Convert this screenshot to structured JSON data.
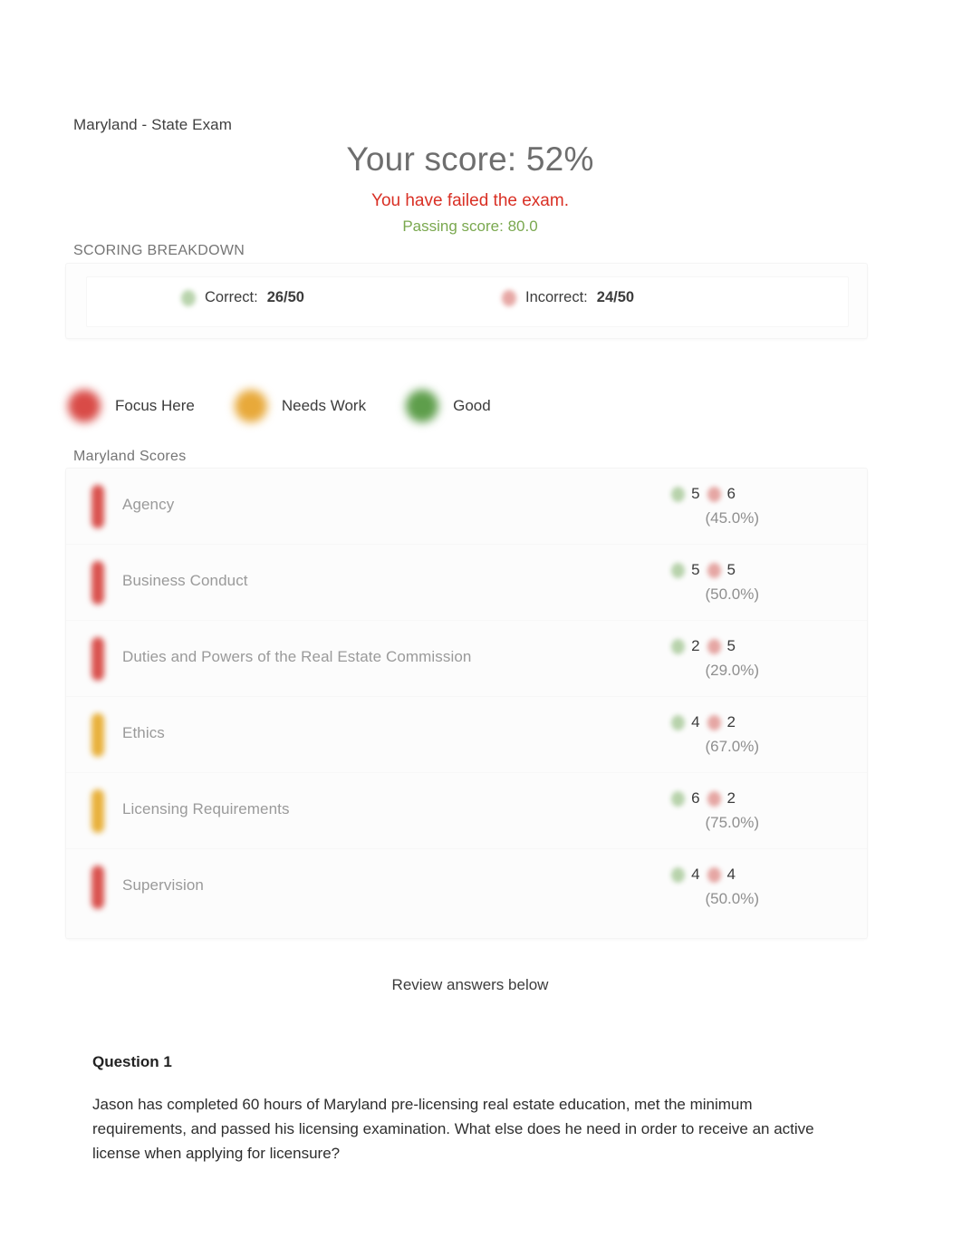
{
  "header": {
    "exam_title": "Maryland - State Exam",
    "score_headline": "Your score: 52%",
    "result_message": "You have failed the exam.",
    "passing_line": "Passing score: 80.0",
    "score_percent": 52,
    "passing_score": "80.0"
  },
  "breakdown": {
    "section_label": "SCORING BREAKDOWN",
    "correct_label": "Correct:",
    "correct_value": "26/50",
    "incorrect_label": "Incorrect:",
    "incorrect_value": "24/50"
  },
  "legend": {
    "items": [
      {
        "label": "Focus Here",
        "color": "#d94b47",
        "key": "red"
      },
      {
        "label": "Needs Work",
        "color": "#e8a93a",
        "key": "yellow"
      },
      {
        "label": "Good",
        "color": "#5e9e4b",
        "key": "green"
      }
    ]
  },
  "scores": {
    "section_label": "Maryland Scores",
    "rows": [
      {
        "topic": "Agency",
        "correct": "5",
        "incorrect": "6",
        "percent": "(45.0%)",
        "status": "red"
      },
      {
        "topic": "Business Conduct",
        "correct": "5",
        "incorrect": "5",
        "percent": "(50.0%)",
        "status": "red"
      },
      {
        "topic": "Duties and Powers of the Real Estate Commission",
        "correct": "2",
        "incorrect": "5",
        "percent": "(29.0%)",
        "status": "red"
      },
      {
        "topic": "Ethics",
        "correct": "4",
        "incorrect": "2",
        "percent": "(67.0%)",
        "status": "yellow"
      },
      {
        "topic": "Licensing Requirements",
        "correct": "6",
        "incorrect": "2",
        "percent": "(75.0%)",
        "status": "yellow"
      },
      {
        "topic": "Supervision",
        "correct": "4",
        "incorrect": "4",
        "percent": "(50.0%)",
        "status": "red"
      }
    ]
  },
  "review": {
    "heading": "Review answers below",
    "question_heading": "Question 1",
    "question_body": "Jason has completed 60 hours of Maryland pre-licensing real estate education, met the minimum requirements, and passed his licensing examination. What else does he need in order to receive an active license when applying for licensure?"
  },
  "colors": {
    "fail": "#d93025",
    "pass": "#7aa84f",
    "correct_icon": "#7fb069",
    "incorrect_icon": "#d3605b"
  },
  "icons": {
    "correct": "check-circle-icon",
    "incorrect": "x-circle-icon",
    "status": "status-bar-icon"
  }
}
